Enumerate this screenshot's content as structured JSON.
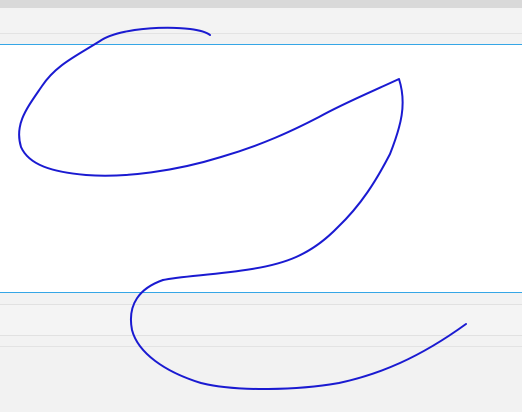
{
  "colors": {
    "background": "#f2f2f2",
    "top_band": "#d9d9d9",
    "canvas": "#ffffff",
    "canvas_border": "#35a6e6",
    "ink": "#1a1ad1"
  }
}
